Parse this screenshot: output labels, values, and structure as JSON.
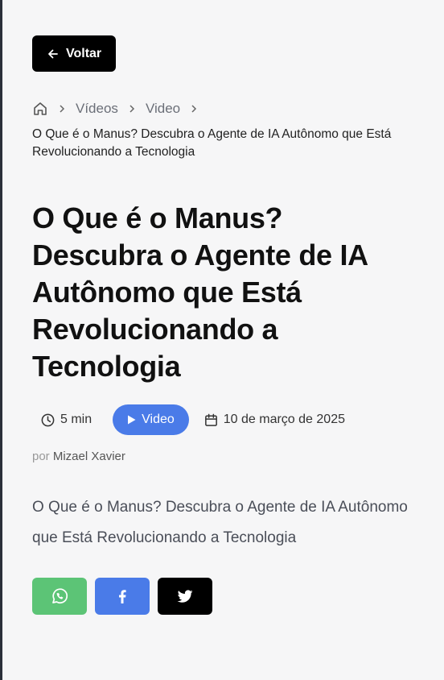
{
  "back_button": {
    "label": "Voltar"
  },
  "breadcrumb": {
    "items": [
      "Vídeos",
      "Video"
    ],
    "current": "O Que é o Manus? Descubra o Agente de IA Autônomo que Está Revolucionando a Tecnologia"
  },
  "article": {
    "title": "O Que é o Manus? Descubra o Agente de IA Autônomo que Está Revolucionando a Tecnologia",
    "reading_time": "5 min",
    "type_badge": "Video",
    "date": "10 de março de 2025",
    "author_prefix": "por",
    "author": "Mizael Xavier",
    "excerpt": "O Que é o Manus? Descubra o Agente de IA Autônomo que Está Revolucionando a Tecnologia"
  },
  "colors": {
    "badge": "#4a7be8",
    "whatsapp": "#5cc476",
    "facebook": "#4a7be8",
    "twitter": "#000000"
  },
  "share": {
    "icons": [
      "whatsapp-icon",
      "facebook-icon",
      "twitter-icon"
    ]
  }
}
